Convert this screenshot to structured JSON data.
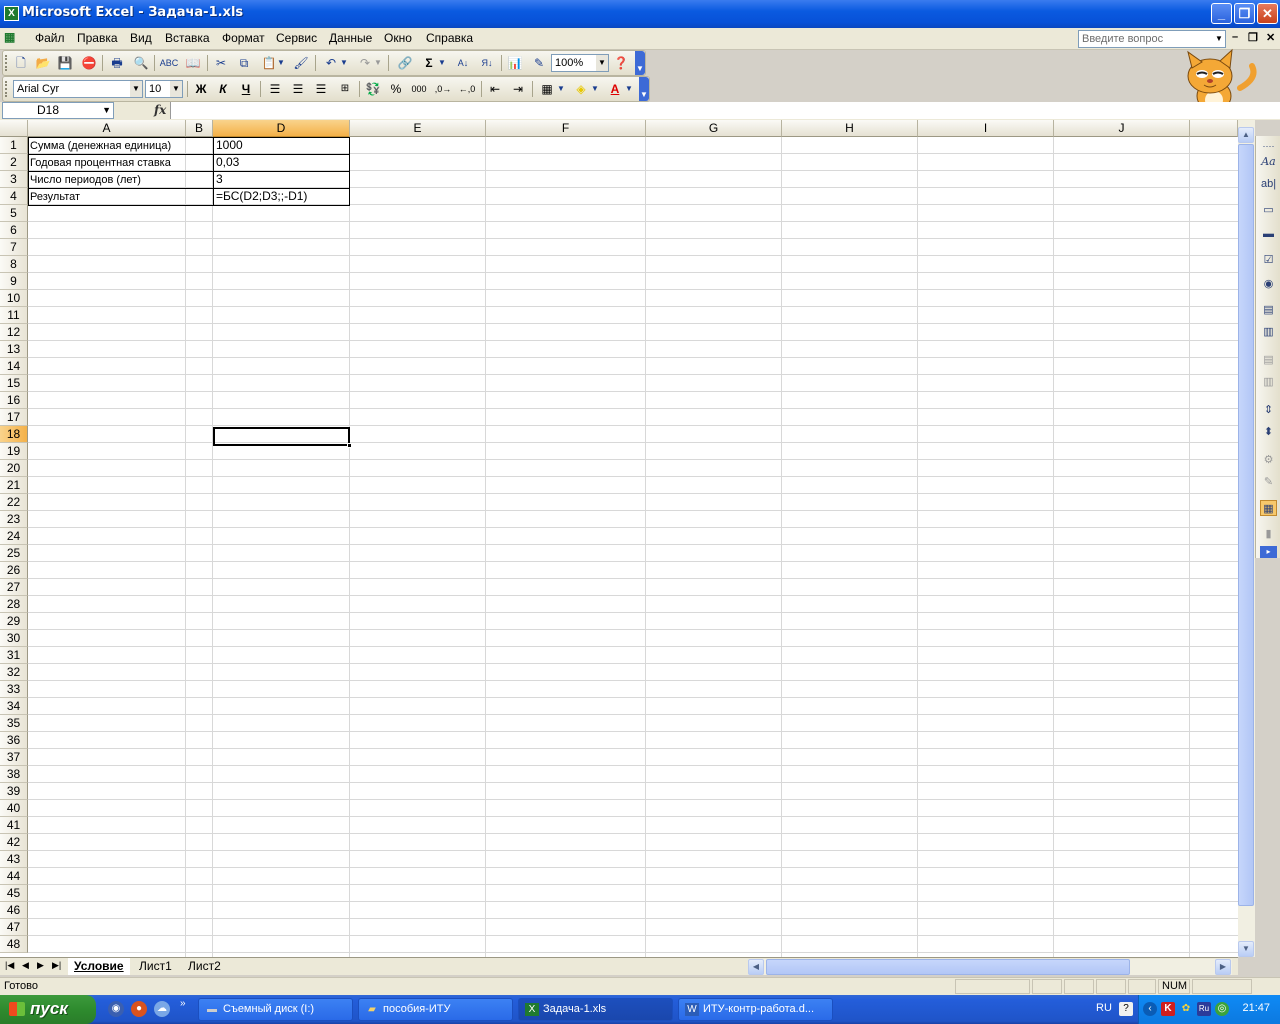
{
  "window": {
    "title": "Microsoft Excel - Задача-1.xls"
  },
  "menu": {
    "items": [
      "Файл",
      "Правка",
      "Вид",
      "Вставка",
      "Формат",
      "Сервис",
      "Данные",
      "Окно",
      "Справка"
    ],
    "ask_placeholder": "Введите вопрос"
  },
  "toolbar": {
    "zoom": "100%",
    "font_name": "Arial Cyr",
    "font_size": "10",
    "bold": "Ж",
    "italic": "К",
    "underline": "Ч",
    "percent": "%",
    "thousands": "000",
    "autosum": "Σ"
  },
  "formula_bar": {
    "name_box": "D18",
    "fx": "fx",
    "content": ""
  },
  "grid": {
    "columns": [
      "A",
      "B",
      "D",
      "E",
      "F",
      "G",
      "H",
      "I",
      "J"
    ],
    "active_column": "D",
    "active_row": 18,
    "row_count": 48,
    "cells": [
      {
        "ref": "A1",
        "value": "Сумма (денежная единица)"
      },
      {
        "ref": "A2",
        "value": "Годовая процентная ставка"
      },
      {
        "ref": "A3",
        "value": "Число периодов (лет)"
      },
      {
        "ref": "A4",
        "value": "Результат"
      },
      {
        "ref": "D1",
        "value": "1000"
      },
      {
        "ref": "D2",
        "value": "0,03"
      },
      {
        "ref": "D3",
        "value": "3"
      },
      {
        "ref": "D4",
        "value": "=БС(D2;D3;;-D1)"
      }
    ]
  },
  "sheets": {
    "tabs": [
      "Условие",
      "Лист1",
      "Лист2"
    ],
    "active": "Условие"
  },
  "status": {
    "text": "Готово",
    "num": "NUM"
  },
  "taskbar": {
    "start": "пуск",
    "tasks": [
      "Съемный диск (I:)",
      "пособия-ИТУ",
      "Задача-1.xls",
      "ИТУ-контр-работа.d..."
    ],
    "lang": "RU",
    "clock": "21:47"
  }
}
